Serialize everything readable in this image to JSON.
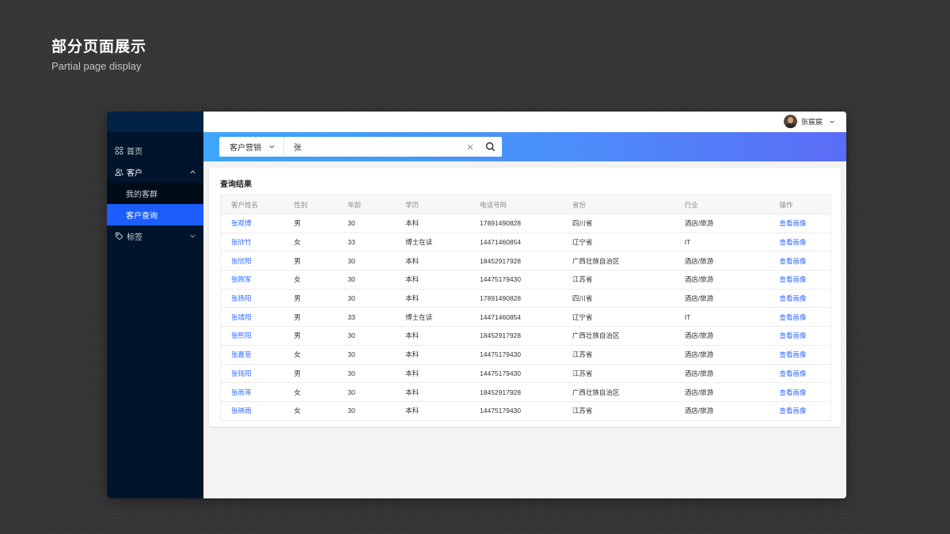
{
  "heading": {
    "title": "部分页面展示",
    "subtitle": "Partial page display"
  },
  "sidebar": {
    "items": [
      {
        "label": "首页",
        "icon": "home-grid-icon"
      },
      {
        "label": "客户",
        "icon": "users-icon",
        "expanded": true
      },
      {
        "label": "我的客群",
        "sub": true
      },
      {
        "label": "客户查询",
        "sub": true,
        "active": true
      },
      {
        "label": "标签",
        "icon": "tag-icon",
        "expanded": false
      }
    ]
  },
  "topbar": {
    "user_name": "张宸宸"
  },
  "search": {
    "category": "客户营销",
    "query": "张"
  },
  "results": {
    "title": "查询结果",
    "columns": [
      "客户姓名",
      "性别",
      "年龄",
      "学历",
      "电话号码",
      "省份",
      "行业",
      "操作"
    ],
    "rows": [
      [
        "张观博",
        "男",
        "30",
        "本科",
        "17891490828",
        "四川省",
        "酒店/旅游",
        "查看画像"
      ],
      [
        "张欣竹",
        "女",
        "33",
        "博士在读",
        "14471460854",
        "辽宁省",
        "IT",
        "查看画像"
      ],
      [
        "张欣阳",
        "男",
        "30",
        "本科",
        "18452917928",
        "广西壮族自治区",
        "酒店/旅游",
        "查看画像"
      ],
      [
        "张刚军",
        "女",
        "30",
        "本科",
        "14475179430",
        "江苏省",
        "酒店/旅游",
        "查看画像"
      ],
      [
        "张扬阳",
        "男",
        "30",
        "本科",
        "17891490828",
        "四川省",
        "酒店/旅游",
        "查看画像"
      ],
      [
        "张靖阳",
        "男",
        "33",
        "博士在读",
        "14471460854",
        "辽宁省",
        "IT",
        "查看画像"
      ],
      [
        "张熙阳",
        "男",
        "30",
        "本科",
        "18452917928",
        "广西壮族自治区",
        "酒店/旅游",
        "查看画像"
      ],
      [
        "张嘉萱",
        "女",
        "30",
        "本科",
        "14475179430",
        "江苏省",
        "酒店/旅游",
        "查看画像"
      ],
      [
        "张铭阳",
        "男",
        "30",
        "本科",
        "14475179430",
        "江苏省",
        "酒店/旅游",
        "查看画像"
      ],
      [
        "张雨荨",
        "女",
        "30",
        "本科",
        "18452917928",
        "广西壮族自治区",
        "酒店/旅游",
        "查看画像"
      ],
      [
        "张晓雨",
        "女",
        "30",
        "本科",
        "14475179430",
        "江苏省",
        "酒店/旅游",
        "查看画像"
      ]
    ]
  },
  "colors": {
    "accent": "#1b5efd",
    "link": "#2f6bff",
    "sidebar_bg": "#00152b",
    "band_start": "#3ea6fb",
    "band_end": "#5b6cf6"
  }
}
